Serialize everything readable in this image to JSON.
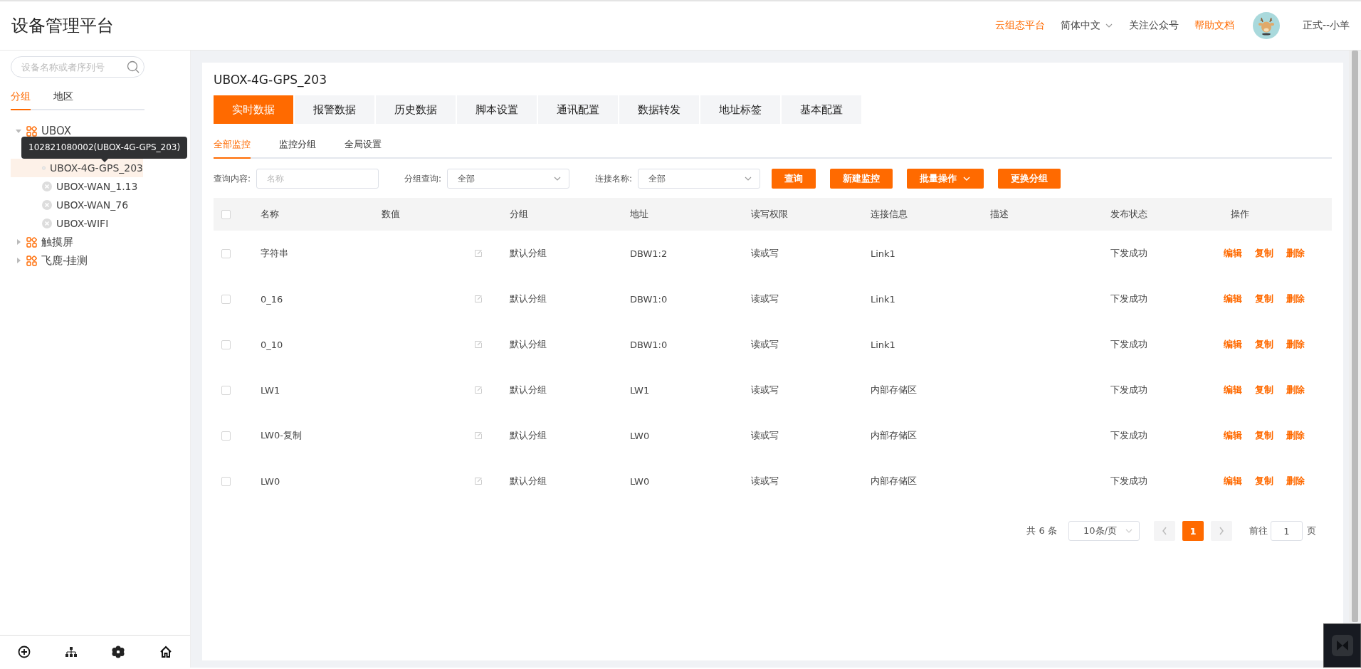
{
  "header": {
    "title": "设备管理平台",
    "links": [
      {
        "label": "云组态平台",
        "kind": "accent"
      },
      {
        "label": "简体中文",
        "kind": "dropdown"
      },
      {
        "label": "关注公众号",
        "kind": "plain"
      },
      {
        "label": "帮助文档",
        "kind": "accent"
      }
    ],
    "user": "正式--小羊"
  },
  "sidebar": {
    "search": {
      "placeholder": "设备名称或者序列号"
    },
    "tabs": [
      {
        "label": "分组",
        "selected": true
      },
      {
        "label": "地区",
        "selected": false
      }
    ],
    "tree": [
      {
        "label": "UBOX",
        "kind": "group",
        "expanded": true,
        "selected": false,
        "children": [
          {
            "label": "UBOX-4G-GPS_203",
            "kind": "device",
            "selected": true
          },
          {
            "label": "UBOX-WAN_1.13",
            "kind": "device",
            "selected": false
          },
          {
            "label": "UBOX-WAN_76",
            "kind": "device",
            "selected": false
          },
          {
            "label": "UBOX-WIFI",
            "kind": "device",
            "selected": false
          }
        ]
      },
      {
        "label": "触摸屏",
        "kind": "group",
        "expanded": false,
        "selected": false
      },
      {
        "label": "飞鹿-挂测",
        "kind": "group",
        "expanded": false,
        "selected": false
      }
    ],
    "tooltip": "102821080002(UBOX-4G-GPS_203)"
  },
  "main": {
    "title": "UBOX-4G-GPS_203",
    "tabs": [
      {
        "label": "实时数据",
        "selected": true
      },
      {
        "label": "报警数据",
        "selected": false
      },
      {
        "label": "历史数据",
        "selected": false
      },
      {
        "label": "脚本设置",
        "selected": false
      },
      {
        "label": "通讯配置",
        "selected": false
      },
      {
        "label": "数据转发",
        "selected": false
      },
      {
        "label": "地址标签",
        "selected": false
      },
      {
        "label": "基本配置",
        "selected": false
      }
    ],
    "subtabs": [
      {
        "label": "全部监控",
        "selected": true
      },
      {
        "label": "监控分组",
        "selected": false
      },
      {
        "label": "全局设置",
        "selected": false
      }
    ],
    "filters": [
      {
        "label": "查询内容:",
        "kind": "input",
        "placeholder": "名称"
      },
      {
        "label": "分组查询:",
        "kind": "select",
        "value": "全部"
      },
      {
        "label": "连接名称:",
        "kind": "select",
        "value": "全部"
      }
    ],
    "buttons": [
      {
        "label": "查询",
        "kind": "plain"
      },
      {
        "label": "新建监控",
        "kind": "plain"
      },
      {
        "label": "批量操作",
        "kind": "dropdown"
      },
      {
        "label": "更换分组",
        "kind": "plain"
      }
    ],
    "table": {
      "all_checked": false,
      "columns": [
        "名称",
        "数值",
        "分组",
        "地址",
        "读写权限",
        "连接信息",
        "描述",
        "发布状态",
        "操作"
      ],
      "rows": [
        {
          "checked": false,
          "name": "字符串",
          "group": "默认分组",
          "address": "DBW1:2",
          "access": "读或写",
          "link": "Link1",
          "status": "下发成功",
          "actions": [
            "编辑",
            "复制",
            "删除"
          ]
        },
        {
          "checked": false,
          "name": "0_16",
          "group": "默认分组",
          "address": "DBW1:0",
          "access": "读或写",
          "link": "Link1",
          "status": "下发成功",
          "actions": [
            "编辑",
            "复制",
            "删除"
          ]
        },
        {
          "checked": false,
          "name": "0_10",
          "group": "默认分组",
          "address": "DBW1:0",
          "access": "读或写",
          "link": "Link1",
          "status": "下发成功",
          "actions": [
            "编辑",
            "复制",
            "删除"
          ]
        },
        {
          "checked": false,
          "name": "LW1",
          "group": "默认分组",
          "address": "LW1",
          "access": "读或写",
          "link": "内部存储区",
          "status": "下发成功",
          "actions": [
            "编辑",
            "复制",
            "删除"
          ]
        },
        {
          "checked": false,
          "name": "LW0-复制",
          "group": "默认分组",
          "address": "LW0",
          "access": "读或写",
          "link": "内部存储区",
          "status": "下发成功",
          "actions": [
            "编辑",
            "复制",
            "删除"
          ]
        },
        {
          "checked": false,
          "name": "LW0",
          "group": "默认分组",
          "address": "LW0",
          "access": "读或写",
          "link": "内部存储区",
          "status": "下发成功",
          "actions": [
            "编辑",
            "复制",
            "删除"
          ]
        }
      ]
    },
    "pagination": {
      "total": "共 6 条",
      "page_size": "10条/页",
      "pages": [
        {
          "label": "1",
          "selected": true
        }
      ],
      "goto_label": "前往",
      "goto_value": "1",
      "goto_suffix": "页"
    }
  }
}
